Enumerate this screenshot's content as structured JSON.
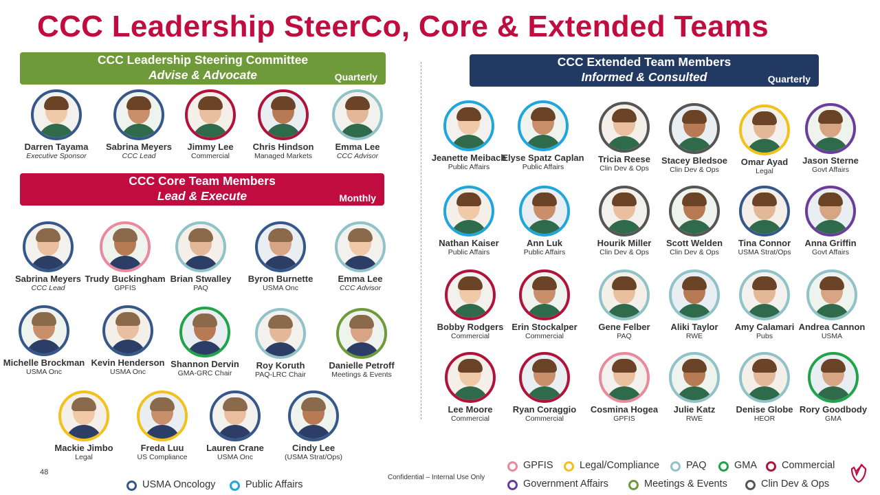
{
  "title": "CCC Leadership SteerCo, Core & Extended Teams",
  "colors": {
    "title": "#c00c3f",
    "steering_banner": "#6e9a3a",
    "core_banner": "#c00c3f",
    "extended_banner": "#223a62",
    "usma_oncology": "#36578a",
    "public_affairs": "#1fa6dc",
    "gpfis": "#e8899c",
    "legal_compliance": "#f2c11b",
    "paq": "#8fc3c8",
    "gma": "#1fa44a",
    "commercial": "#b0123a",
    "government_affairs": "#6a3d9a",
    "meetings_events": "#6e9a3a",
    "clin_dev_ops": "#555555"
  },
  "steering": {
    "line1": "CCC Leadership Steering Committee",
    "line2": "Advise & Advocate",
    "frequency": "Quarterly",
    "members": [
      {
        "name": "Darren Tayama",
        "role": "Executive Sponsor",
        "ring": "usma_oncology"
      },
      {
        "name": "Sabrina Meyers",
        "role": "CCC Lead",
        "ring": "usma_oncology"
      },
      {
        "name": "Jimmy Lee",
        "role": "Commercial",
        "ring": "commercial"
      },
      {
        "name": "Chris Hindson",
        "role": "Managed Markets",
        "ring": "commercial"
      },
      {
        "name": "Emma Lee",
        "role": "CCC Advisor",
        "ring": "paq"
      }
    ]
  },
  "core": {
    "line1": "CCC Core Team Members",
    "line2": "Lead & Execute",
    "frequency": "Monthly",
    "members": [
      {
        "name": "Sabrina Meyers",
        "role": "CCC Lead",
        "ring": "usma_oncology"
      },
      {
        "name": "Trudy Buckingham",
        "role": "GPFIS",
        "ring": "gpfis"
      },
      {
        "name": "Brian Stwalley",
        "role": "PAQ",
        "ring": "paq"
      },
      {
        "name": "Byron Burnette",
        "role": "USMA Onc",
        "ring": "usma_oncology"
      },
      {
        "name": "Emma Lee",
        "role": "CCC Advisor",
        "ring": "paq"
      },
      {
        "name": "Michelle Brockman",
        "role": "USMA Onc",
        "ring": "usma_oncology"
      },
      {
        "name": "Kevin Henderson",
        "role": "USMA Onc",
        "ring": "usma_oncology"
      },
      {
        "name": "Shannon Dervin",
        "role": "GMA-GRC Chair",
        "ring": "gma"
      },
      {
        "name": "Roy Koruth",
        "role": "PAQ-LRC Chair",
        "ring": "paq"
      },
      {
        "name": "Danielle Petroff",
        "role": "Meetings & Events",
        "ring": "meetings_events"
      },
      {
        "name": "Mackie Jimbo",
        "role": "Legal",
        "ring": "legal_compliance"
      },
      {
        "name": "Freda Luu",
        "role": "US Compliance",
        "ring": "legal_compliance"
      },
      {
        "name": "Lauren Crane",
        "role": "USMA Onc",
        "ring": "usma_oncology"
      },
      {
        "name": "Cindy Lee",
        "role": "(USMA Strat/Ops)",
        "ring": "usma_oncology"
      }
    ]
  },
  "extended": {
    "line1": "CCC Extended Team Members",
    "line2": "Informed & Consulted",
    "frequency": "Quarterly",
    "members": [
      {
        "name": "Jeanette Meibach",
        "role": "Public Affairs",
        "ring": "public_affairs"
      },
      {
        "name": "Elyse Spatz Caplan",
        "role": "Public Affairs",
        "ring": "public_affairs"
      },
      {
        "name": "Tricia Reese",
        "role": "Clin Dev & Ops",
        "ring": "clin_dev_ops"
      },
      {
        "name": "Stacey Bledsoe",
        "role": "Clin Dev & Ops",
        "ring": "clin_dev_ops"
      },
      {
        "name": "Omar Ayad",
        "role": "Legal",
        "ring": "legal_compliance"
      },
      {
        "name": "Jason Sterne",
        "role": "Govt Affairs",
        "ring": "government_affairs"
      },
      {
        "name": "Nathan Kaiser",
        "role": "Public Affairs",
        "ring": "public_affairs"
      },
      {
        "name": "Ann Luk",
        "role": "Public Affairs",
        "ring": "public_affairs"
      },
      {
        "name": "Hourik Miller",
        "role": "Clin Dev & Ops",
        "ring": "clin_dev_ops"
      },
      {
        "name": "Scott Welden",
        "role": "Clin Dev & Ops",
        "ring": "clin_dev_ops"
      },
      {
        "name": "Tina Connor",
        "role": "USMA Strat/Ops",
        "ring": "usma_oncology"
      },
      {
        "name": "Anna Griffin",
        "role": "Govt Affairs",
        "ring": "government_affairs"
      },
      {
        "name": "Bobby Rodgers",
        "role": "Commercial",
        "ring": "commercial"
      },
      {
        "name": "Erin Stockalper",
        "role": "Commercial",
        "ring": "commercial"
      },
      {
        "name": "Gene Felber",
        "role": "PAQ",
        "ring": "paq"
      },
      {
        "name": "Aliki Taylor",
        "role": "RWE",
        "ring": "paq"
      },
      {
        "name": "Amy Calamari",
        "role": "Pubs",
        "ring": "paq"
      },
      {
        "name": "Andrea Cannon",
        "role": "USMA",
        "ring": "paq"
      },
      {
        "name": "Lee Moore",
        "role": "Commercial",
        "ring": "commercial"
      },
      {
        "name": "Ryan Coraggio",
        "role": "Commercial",
        "ring": "commercial"
      },
      {
        "name": "Cosmina Hogea",
        "role": "GPFIS",
        "ring": "gpfis"
      },
      {
        "name": "Julie Katz",
        "role": "RWE",
        "ring": "paq"
      },
      {
        "name": "Denise Globe",
        "role": "HEOR",
        "ring": "paq"
      },
      {
        "name": "Rory Goodbody",
        "role": "GMA",
        "ring": "gma"
      }
    ]
  },
  "legend": {
    "items": [
      {
        "label": "GPFIS",
        "ring": "gpfis"
      },
      {
        "label": "Legal/Compliance",
        "ring": "legal_compliance"
      },
      {
        "label": "PAQ",
        "ring": "paq"
      },
      {
        "label": "GMA",
        "ring": "gma"
      },
      {
        "label": "Commercial",
        "ring": "commercial"
      },
      {
        "label": "Government Affairs",
        "ring": "government_affairs"
      },
      {
        "label": "Meetings & Events",
        "ring": "meetings_events"
      },
      {
        "label": "Clin Dev & Ops",
        "ring": "clin_dev_ops"
      },
      {
        "label": "USMA Oncology",
        "ring": "usma_oncology"
      },
      {
        "label": "Public Affairs",
        "ring": "public_affairs"
      }
    ]
  },
  "footer": {
    "page_number": "48",
    "confidential": "Confidential – Internal Use Only"
  }
}
